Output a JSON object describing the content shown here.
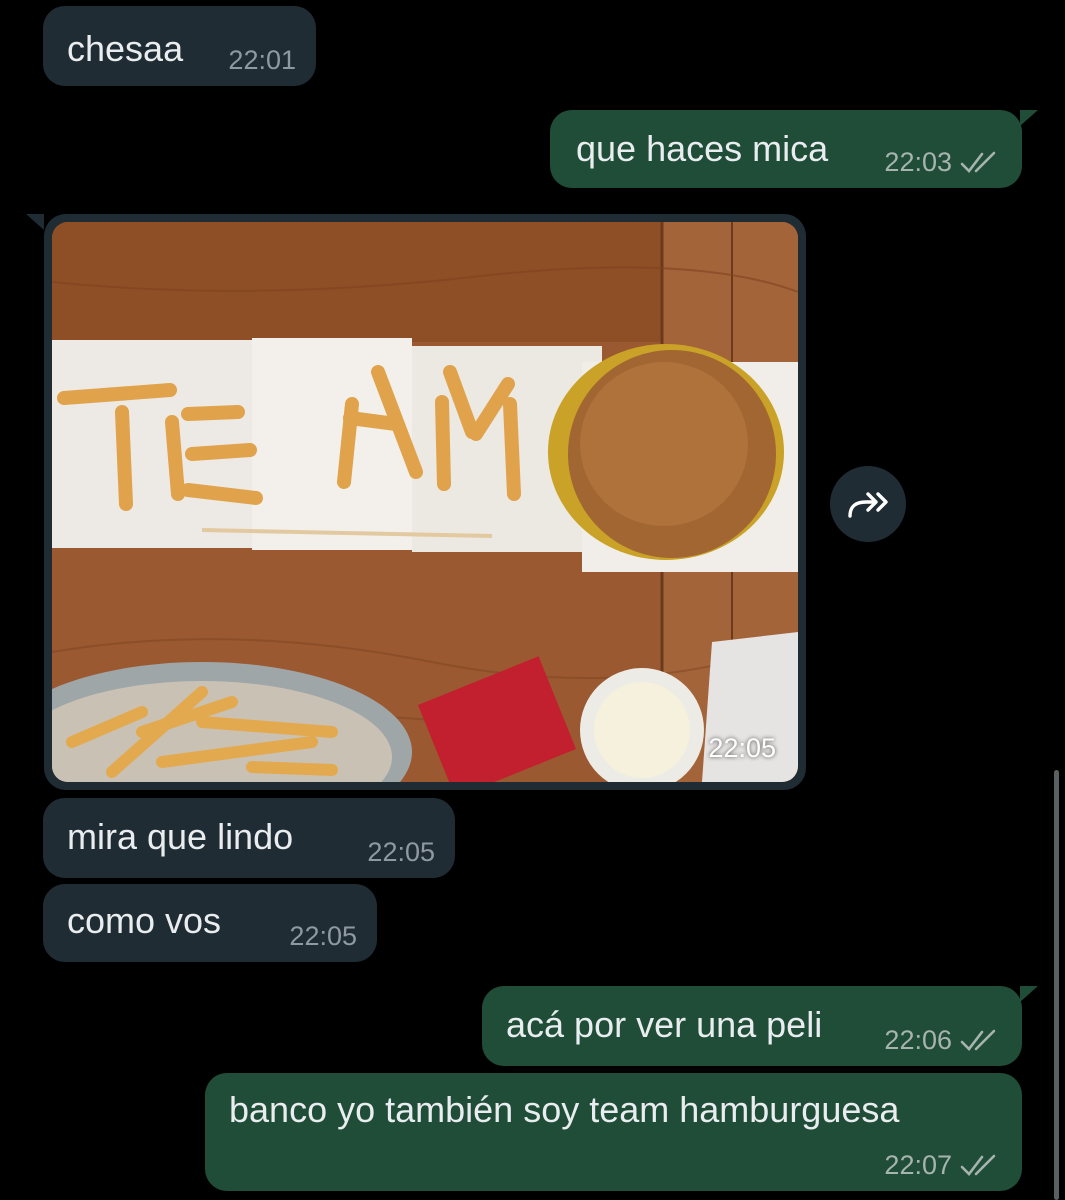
{
  "colors": {
    "background": "#000000",
    "incoming_bubble": "#202C33",
    "outgoing_bubble": "#1F4D38",
    "text": "#E9EDEF",
    "meta_text": "#A7B3AE"
  },
  "messages": [
    {
      "direction": "incoming",
      "text": "chesaa",
      "time": "22:01"
    },
    {
      "direction": "outgoing",
      "text": "que haces mica",
      "time": "22:03",
      "status_icon": "double-check-icon"
    },
    {
      "direction": "incoming",
      "type": "image",
      "image_text": "TE AM",
      "time": "22:05",
      "forward_icon": "forward-icon"
    },
    {
      "direction": "incoming",
      "text": "mira que lindo",
      "time": "22:05"
    },
    {
      "direction": "incoming",
      "text": "como vos",
      "time": "22:05"
    },
    {
      "direction": "outgoing",
      "text": "acá por ver una peli",
      "time": "22:06",
      "status_icon": "double-check-icon"
    },
    {
      "direction": "outgoing",
      "text": "banco yo también soy team hamburguesa",
      "time": "22:07",
      "status_icon": "double-check-icon"
    }
  ]
}
